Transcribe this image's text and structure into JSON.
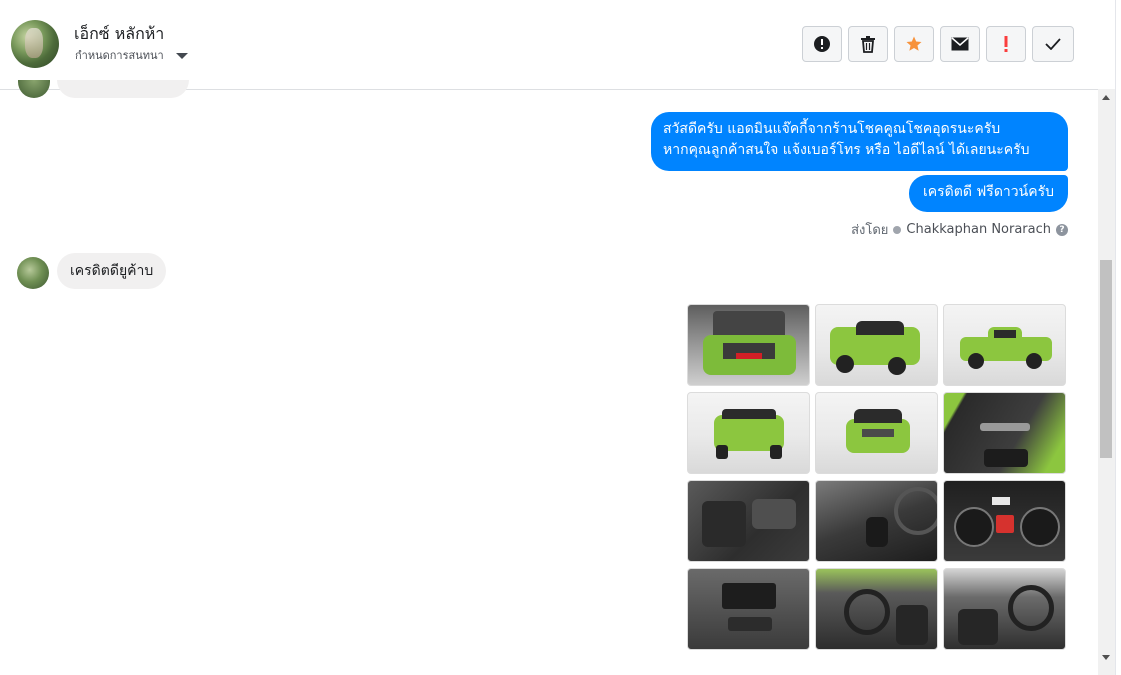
{
  "header": {
    "contact_name": "เอ็กซ์ หลักห้า",
    "subtitle": "กำหนดการสนทนา",
    "actions": [
      {
        "icon": "alert-circle-icon",
        "name": "report-button"
      },
      {
        "icon": "trash-icon",
        "name": "delete-button"
      },
      {
        "icon": "star-icon",
        "name": "star-button",
        "color": "#f7923b"
      },
      {
        "icon": "envelope-icon",
        "name": "mark-unread-button"
      },
      {
        "icon": "exclamation-icon",
        "name": "spam-button",
        "color": "#fa3e3e"
      },
      {
        "icon": "check-icon",
        "name": "done-button"
      }
    ]
  },
  "messages": {
    "outgoing_1_line1": "สวัสดีครับ แอดมินแจ๊คกี้จากร้านโชคคูณโชคอุดรนะครับ",
    "outgoing_1_line2": "หากคุณลูกค้าสนใจ แจ้งเบอร์โทร หรือ ไอดีไลน์ ได้เลยนะครับ",
    "outgoing_2": "เครดิตดี ฟรีดาวน์ครับ",
    "sent_by_label": "ส่งโดย",
    "sent_by_name": "Chakkaphan Norarach",
    "incoming_1": "เครดิตดียูค้าบ"
  },
  "colors": {
    "outgoing_bubble": "#0084ff",
    "incoming_bubble": "#f1f0f0",
    "truck_green": "#8cc63f"
  },
  "photos": [
    "engine-bay-photo",
    "truck-front-angle-photo",
    "truck-side-photo",
    "truck-rear-photo",
    "truck-front-photo",
    "door-panel-photo",
    "rear-seat-photo",
    "gear-shifter-photo",
    "instrument-cluster-photo",
    "center-console-photo",
    "cabin-front-photo",
    "cabin-driver-photo"
  ]
}
